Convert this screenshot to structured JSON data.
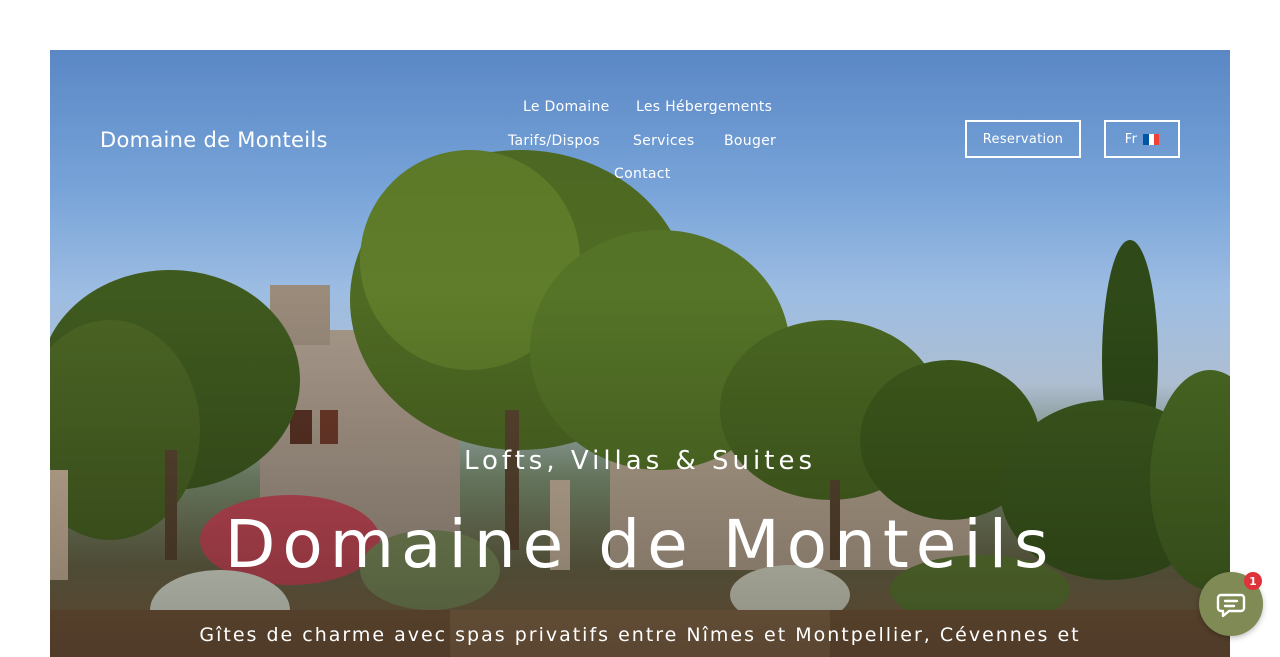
{
  "header": {
    "brand": "Domaine de Monteils",
    "nav": [
      {
        "label": "Le Domaine"
      },
      {
        "label": "Les Hébergements"
      },
      {
        "label": "Tarifs/Dispos"
      },
      {
        "label": "Services"
      },
      {
        "label": "Bouger"
      },
      {
        "label": "Contact"
      }
    ],
    "reservation_label": "Reservation",
    "language_label": "Fr",
    "language_flag_icon": "french-flag-icon"
  },
  "hero": {
    "eyebrow": "Lofts, Villas & Suites",
    "title": "Domaine de Monteils",
    "subtitle": "Gîtes de charme avec spas privatifs entre Nîmes et Montpellier, Cévennes et"
  },
  "chat_widget": {
    "icon": "chat-bubble-icon",
    "badge_count": "1",
    "color": "#7f8a55"
  },
  "colors": {
    "flag_blue": "#0055a4",
    "flag_white": "#ffffff",
    "flag_red": "#ef4135",
    "badge_red": "#e0323a"
  }
}
